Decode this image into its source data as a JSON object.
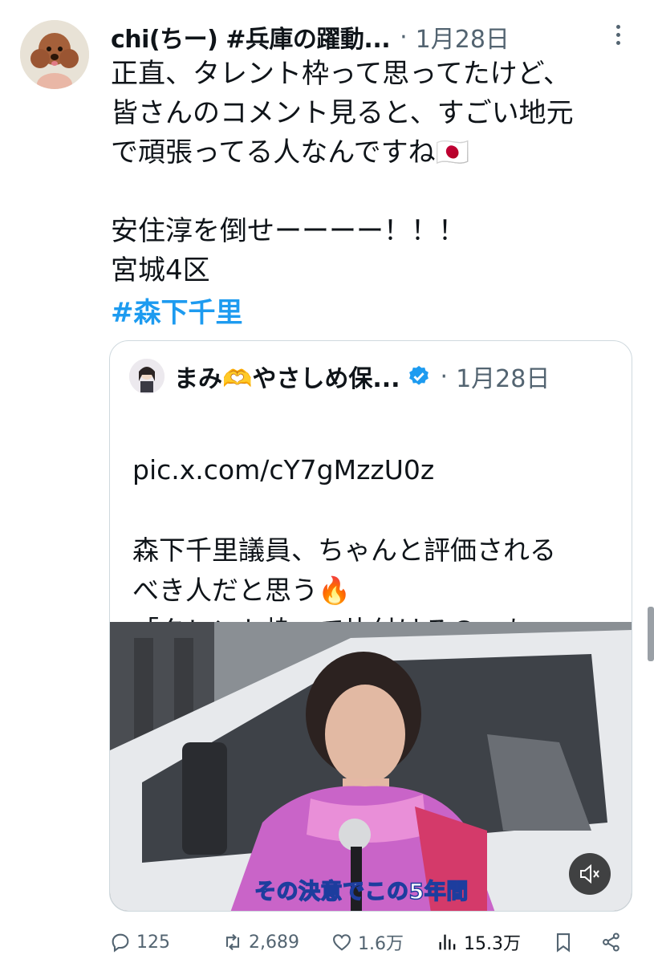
{
  "tweet": {
    "author_name": "chi(ちー) #兵庫の躍動...",
    "separator": "·",
    "timestamp": "1月28日",
    "text": "正直、タレント枠って思ってたけど、\n皆さんのコメント見ると、すごい地元\nで頑張ってる人なんですね🇯🇵\n\n安住淳を倒せーーーー！！！\n宮城4区",
    "hashtag": "#森下千里"
  },
  "quote": {
    "author_name": "まみ🫶やさしめ保...",
    "separator": "·",
    "timestamp": "1月28日",
    "link": "pic.x.com/cY7gMzzU0z",
    "text": "森下千里議員、ちゃんと評価される\nべき人だと思う🔥\n「タレント枠」で片付けるの、もっ\nたいなさすぎ。...",
    "video_caption": "その決意でこの5年間"
  },
  "actions": {
    "replies": "125",
    "reposts": "2,689",
    "likes": "1.6万",
    "views": "15.3万"
  },
  "colors": {
    "accent": "#1d9bf0",
    "text": "#0f1419",
    "secondary": "#536471",
    "border": "#cfd9de"
  },
  "icons": [
    "more-icon",
    "verified-badge-icon",
    "mute-icon",
    "reply-icon",
    "repost-icon",
    "like-icon",
    "views-icon",
    "bookmark-icon",
    "share-icon"
  ]
}
